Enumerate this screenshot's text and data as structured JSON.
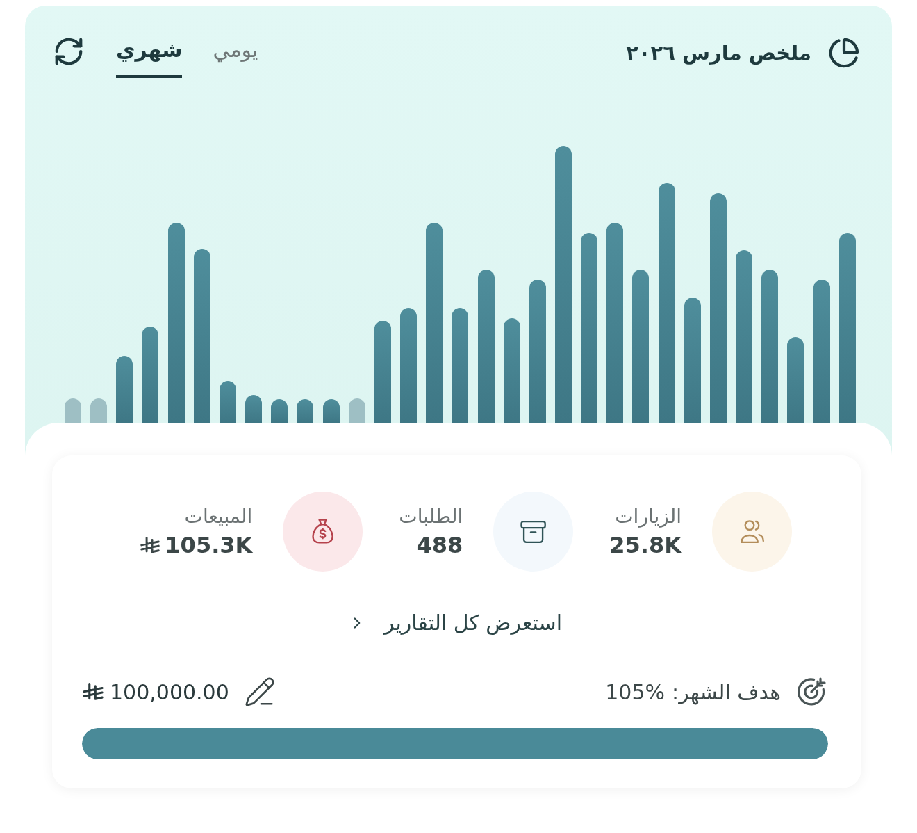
{
  "header": {
    "title": "ملخص مارس ٢٠٢٦",
    "tabs": [
      {
        "label": "يومي",
        "selected": false
      },
      {
        "label": "شهري",
        "selected": true
      }
    ]
  },
  "stats": [
    {
      "kind": "visits",
      "label": "الزيارات",
      "value": "25.8K",
      "currency": false,
      "color": "#fcf5ea"
    },
    {
      "kind": "orders",
      "label": "الطلبات",
      "value": "488",
      "currency": false,
      "color": "#f3f8fc"
    },
    {
      "kind": "sales",
      "label": "المبيعات",
      "value": "105.3K",
      "currency": true,
      "color": "#fbe8ea"
    }
  ],
  "reports_link": {
    "label": "استعرض كل التقارير"
  },
  "goal": {
    "label": "هدف الشهر:",
    "percent": "105%",
    "amount": "100,000.00",
    "level": 1
  }
}
